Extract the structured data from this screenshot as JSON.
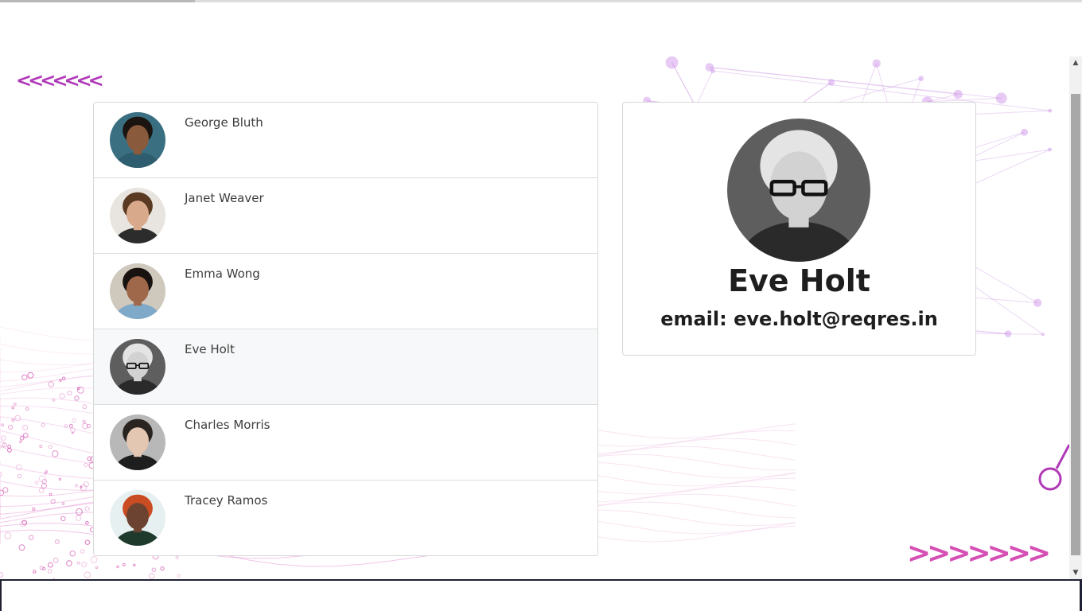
{
  "navigation": {
    "prev_arrows": "<<<<<<<",
    "next_arrows": ">>>>>>>"
  },
  "users": [
    {
      "name": "George Bluth",
      "avatar_colors": {
        "bg": "#3a6f82",
        "skin": "#8a5a3c",
        "hair": "#1b1410",
        "shirt": "#2d5d6e"
      }
    },
    {
      "name": "Janet Weaver",
      "avatar_colors": {
        "bg": "#e8e4df",
        "skin": "#d8a98a",
        "hair": "#5a3a22",
        "shirt": "#2c2c2c"
      }
    },
    {
      "name": "Emma Wong",
      "avatar_colors": {
        "bg": "#cfc8bd",
        "skin": "#a0684a",
        "hair": "#181210",
        "shirt": "#7fa9c9"
      }
    },
    {
      "name": "Eve Holt",
      "avatar_colors": {
        "bg": "#5e5e5e",
        "skin": "#d2d2d2",
        "hair": "#e4e4e4",
        "shirt": "#2a2a2a"
      }
    },
    {
      "name": "Charles Morris",
      "avatar_colors": {
        "bg": "#b8b8b8",
        "skin": "#e3c7b3",
        "hair": "#2a2420",
        "shirt": "#1e1e1e"
      }
    },
    {
      "name": "Tracey Ramos",
      "avatar_colors": {
        "bg": "#e6f0f1",
        "skin": "#6b4330",
        "hair": "#c94c23",
        "shirt": "#1d3a2c"
      }
    }
  ],
  "selected_user": {
    "name": "Eve Holt",
    "email_line": "email: eve.holt@reqres.in"
  },
  "colors": {
    "accent_purple": "#b03ab8",
    "accent_pink": "#d64fb4",
    "selected_row_bg": "#f7f8f9"
  }
}
